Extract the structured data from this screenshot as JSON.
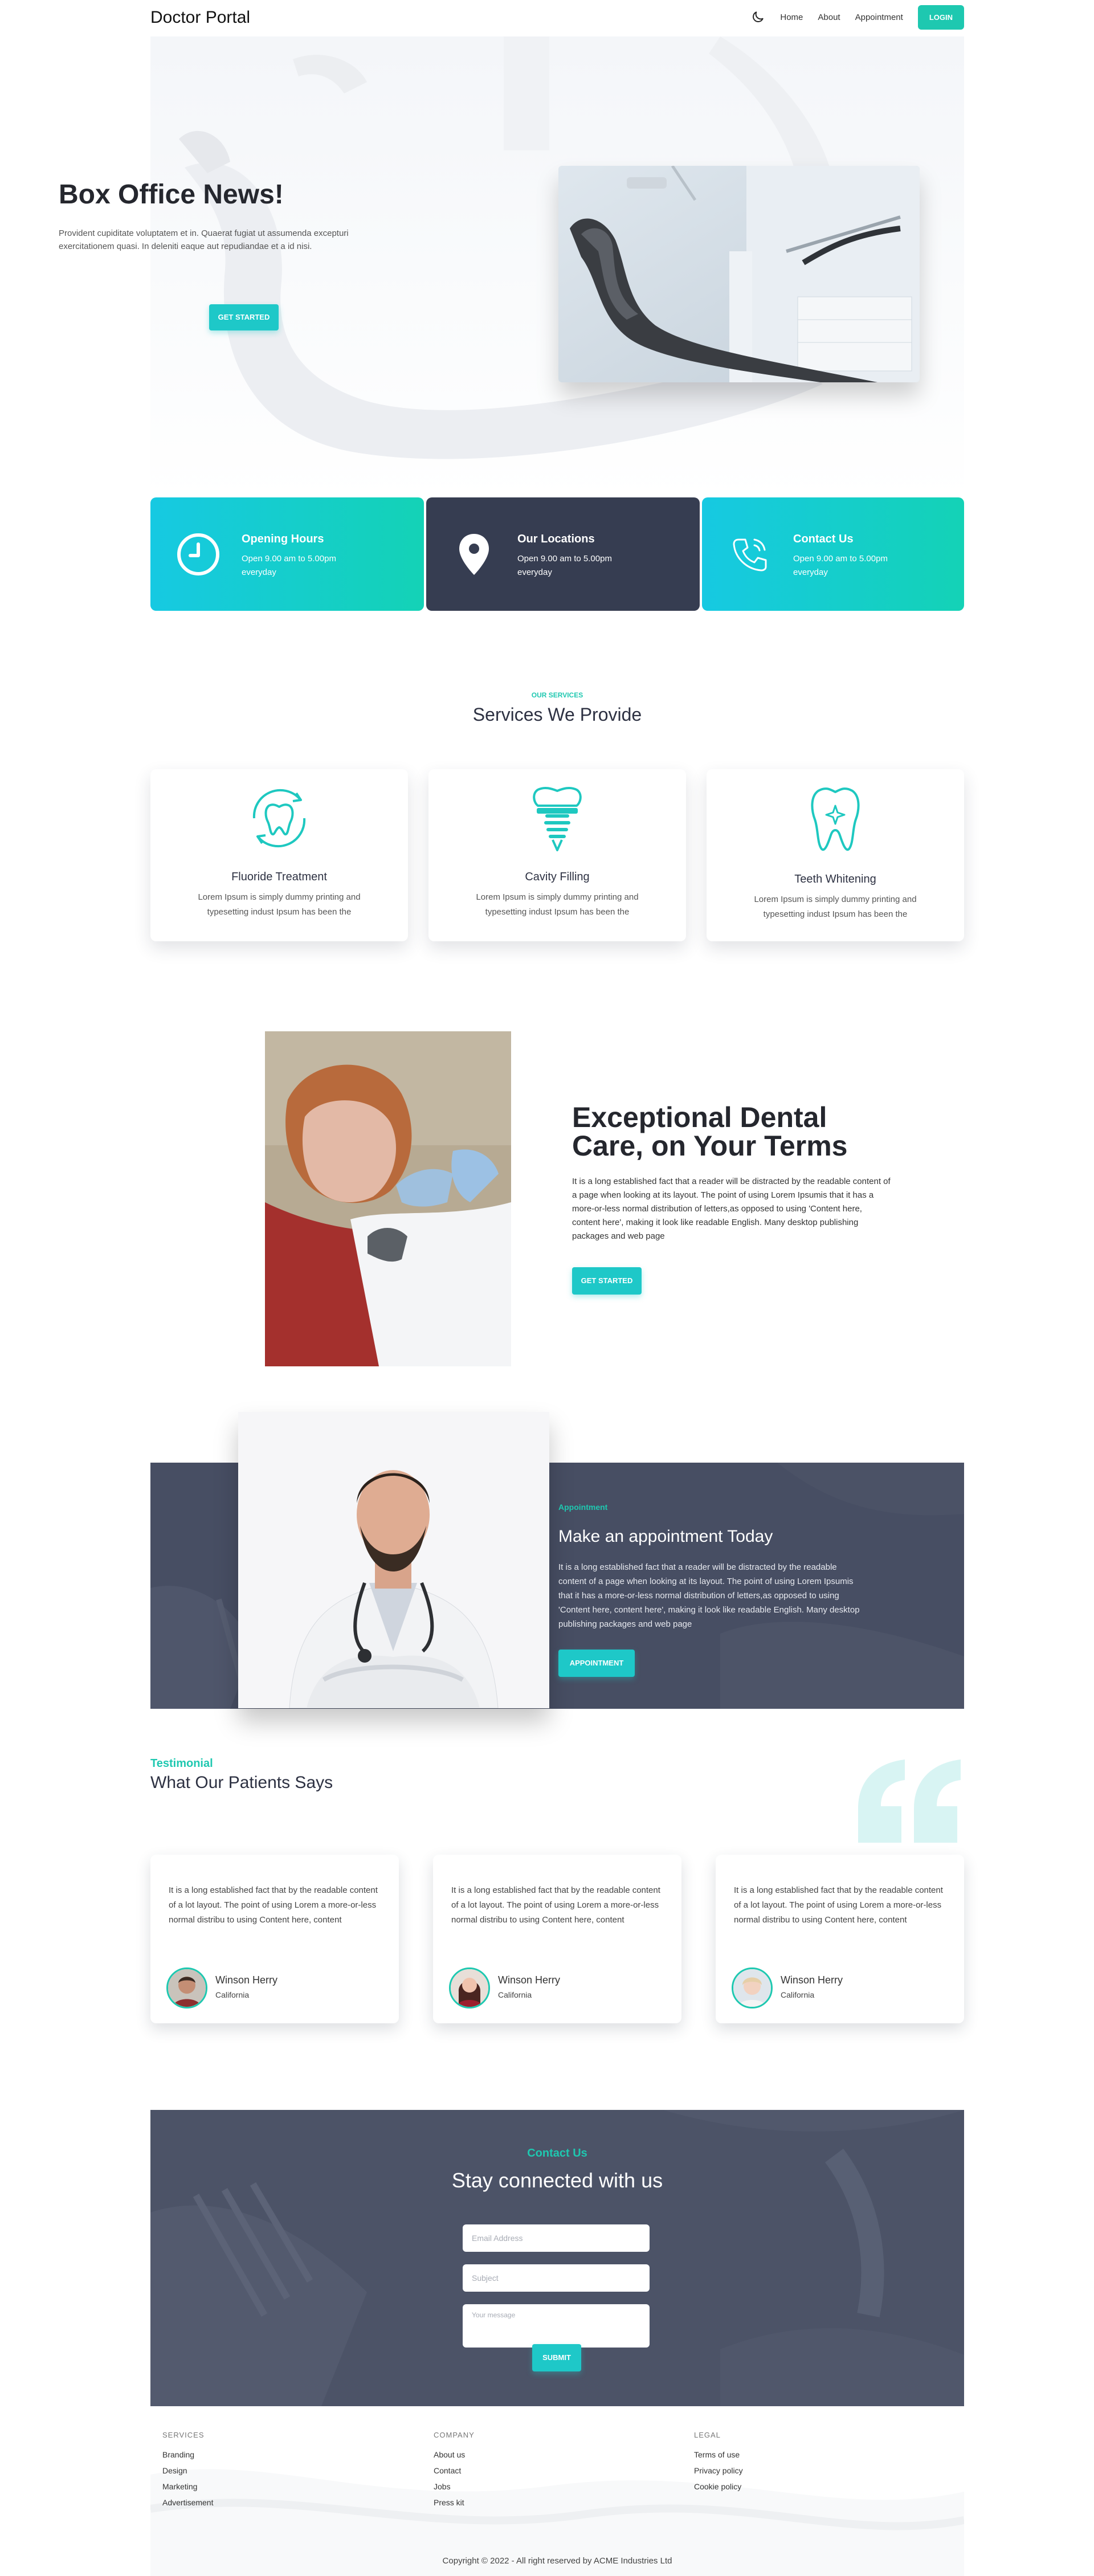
{
  "nav": {
    "brand": "Doctor Portal",
    "links": [
      "Home",
      "About",
      "Appointment"
    ],
    "login": "LOGIN",
    "theme_icon": "moon-icon"
  },
  "hero": {
    "title": "Box Office News!",
    "subtitle": "Provident cupiditate voluptatem et in. Quaerat fugiat ut assumenda excepturi exercitationem quasi. In deleniti eaque aut repudiandae et a id nisi.",
    "cta": "GET STARTED"
  },
  "info_cards": [
    {
      "title": "Opening Hours",
      "desc": "Open 9.00 am to 5.00pm everyday",
      "icon": "clock-icon"
    },
    {
      "title": "Our Locations",
      "desc": "Open 9.00 am to 5.00pm everyday",
      "icon": "map-pin-icon"
    },
    {
      "title": "Contact Us",
      "desc": "Open 9.00 am to 5.00pm everyday",
      "icon": "phone-icon"
    }
  ],
  "services": {
    "eyebrow": "OUR SERVICES",
    "title": "Services We Provide",
    "items": [
      {
        "title": "Fluoride Treatment",
        "desc": "Lorem Ipsum is simply dummy printing and typesetting indust Ipsum has been the",
        "icon": "tooth-refresh-icon"
      },
      {
        "title": "Cavity Filling",
        "desc": "Lorem Ipsum is simply dummy printing and typesetting indust Ipsum has been the",
        "icon": "tooth-implant-icon"
      },
      {
        "title": "Teeth Whitening",
        "desc": "Lorem Ipsum is simply dummy printing and typesetting indust Ipsum has been the",
        "icon": "tooth-sparkle-icon"
      }
    ]
  },
  "exceptional": {
    "title": "Exceptional Dental Care, on Your Terms",
    "text": "It is a long established fact that a reader will be distracted by the readable content of a page when looking at its layout. The point of using Lorem Ipsumis that it has a more-or-less normal distribution of letters,as opposed to using 'Content here, content here', making it look like readable English. Many desktop publishing packages and web page",
    "cta": "GET STARTED"
  },
  "appointment": {
    "eyebrow": "Appointment",
    "title": "Make an appointment Today",
    "text": "It is a long established fact that a reader will be distracted by the readable content of a page when looking at its layout. The point of using Lorem Ipsumis that it has a more-or-less normal distribution of letters,as opposed to using 'Content here, content here', making it look like readable English. Many desktop publishing packages and web page",
    "cta": "APPOINTMENT"
  },
  "testimonials": {
    "eyebrow": "Testimonial",
    "title": "What Our Patients Says",
    "items": [
      {
        "quote": "It is a long established fact that by the readable content of a lot layout. The point of using Lorem a more-or-less normal distribu to using Content here, content",
        "name": "Winson Herry",
        "location": "California"
      },
      {
        "quote": "It is a long established fact that by the readable content of a lot layout. The point of using Lorem a more-or-less normal distribu to using Content here, content",
        "name": "Winson Herry",
        "location": "California"
      },
      {
        "quote": "It is a long established fact that by the readable content of a lot layout. The point of using Lorem a more-or-less normal distribu to using Content here, content",
        "name": "Winson Herry",
        "location": "California"
      }
    ]
  },
  "contact": {
    "eyebrow": "Contact Us",
    "title": "Stay connected with us",
    "email_placeholder": "Email Address",
    "subject_placeholder": "Subject",
    "message_placeholder": "Your message",
    "submit": "SUBMIT"
  },
  "footer": {
    "columns": [
      {
        "heading": "SERVICES",
        "links": [
          "Branding",
          "Design",
          "Marketing",
          "Advertisement"
        ]
      },
      {
        "heading": "COMPANY",
        "links": [
          "About us",
          "Contact",
          "Jobs",
          "Press kit"
        ]
      },
      {
        "heading": "LEGAL",
        "links": [
          "Terms of use",
          "Privacy policy",
          "Cookie policy"
        ]
      }
    ],
    "copyright": "Copyright © 2022 - All right reserved by ACME Industries Ltd"
  },
  "colors": {
    "accent": "#1ec8b0",
    "accent_cyan": "#1ec8c8",
    "dark_card": "#363d51",
    "dark_section": "#474e63"
  }
}
